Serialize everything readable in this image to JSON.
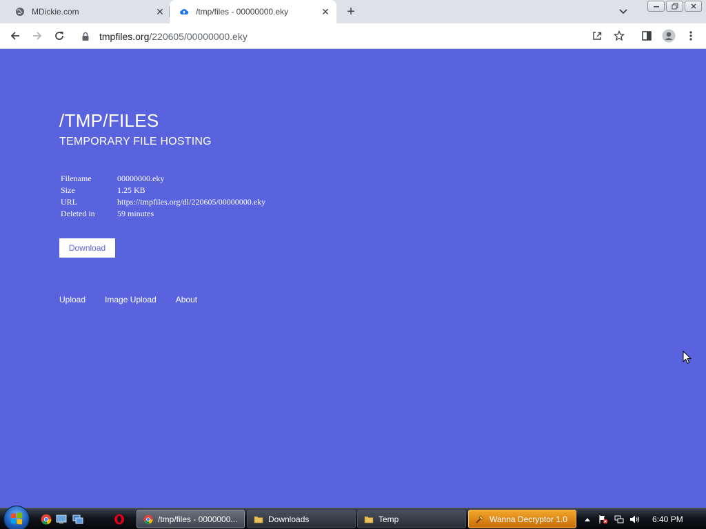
{
  "browser": {
    "tabs": [
      {
        "title": "MDickie.com",
        "favicon": "globe-icon"
      },
      {
        "title": "/tmp/files - 00000000.eky",
        "favicon": "cloud-upload-icon"
      }
    ],
    "address": {
      "host": "tmpfiles.org",
      "path": "/220605/00000000.eky"
    }
  },
  "page": {
    "title": "/TMP/FILES",
    "subtitle": "TEMPORARY FILE HOSTING",
    "file_info": [
      {
        "key": "Filename",
        "value": "00000000.eky"
      },
      {
        "key": "Size",
        "value": "1.25 KB"
      },
      {
        "key": "URL",
        "value": "https://tmpfiles.org/dl/220605/00000000.eky"
      },
      {
        "key": "Deleted in",
        "value": "59 minutes"
      }
    ],
    "download_label": "Download",
    "footer_links": [
      "Upload",
      "Image Upload",
      "About"
    ]
  },
  "taskbar": {
    "tasks": [
      {
        "label": "/tmp/files - 0000000...",
        "icon": "chrome-icon"
      },
      {
        "label": "Downloads",
        "icon": "folder-icon"
      },
      {
        "label": "Temp",
        "icon": "folder-icon"
      },
      {
        "label": "Wanna Decryptor 1.0",
        "icon": "wanna-decryptor-icon"
      }
    ],
    "clock": "6:40 PM"
  },
  "colors": {
    "page_background": "#5a63de",
    "tab_strip": "#dee1e6",
    "decryptor_task": "#e08a1a"
  }
}
